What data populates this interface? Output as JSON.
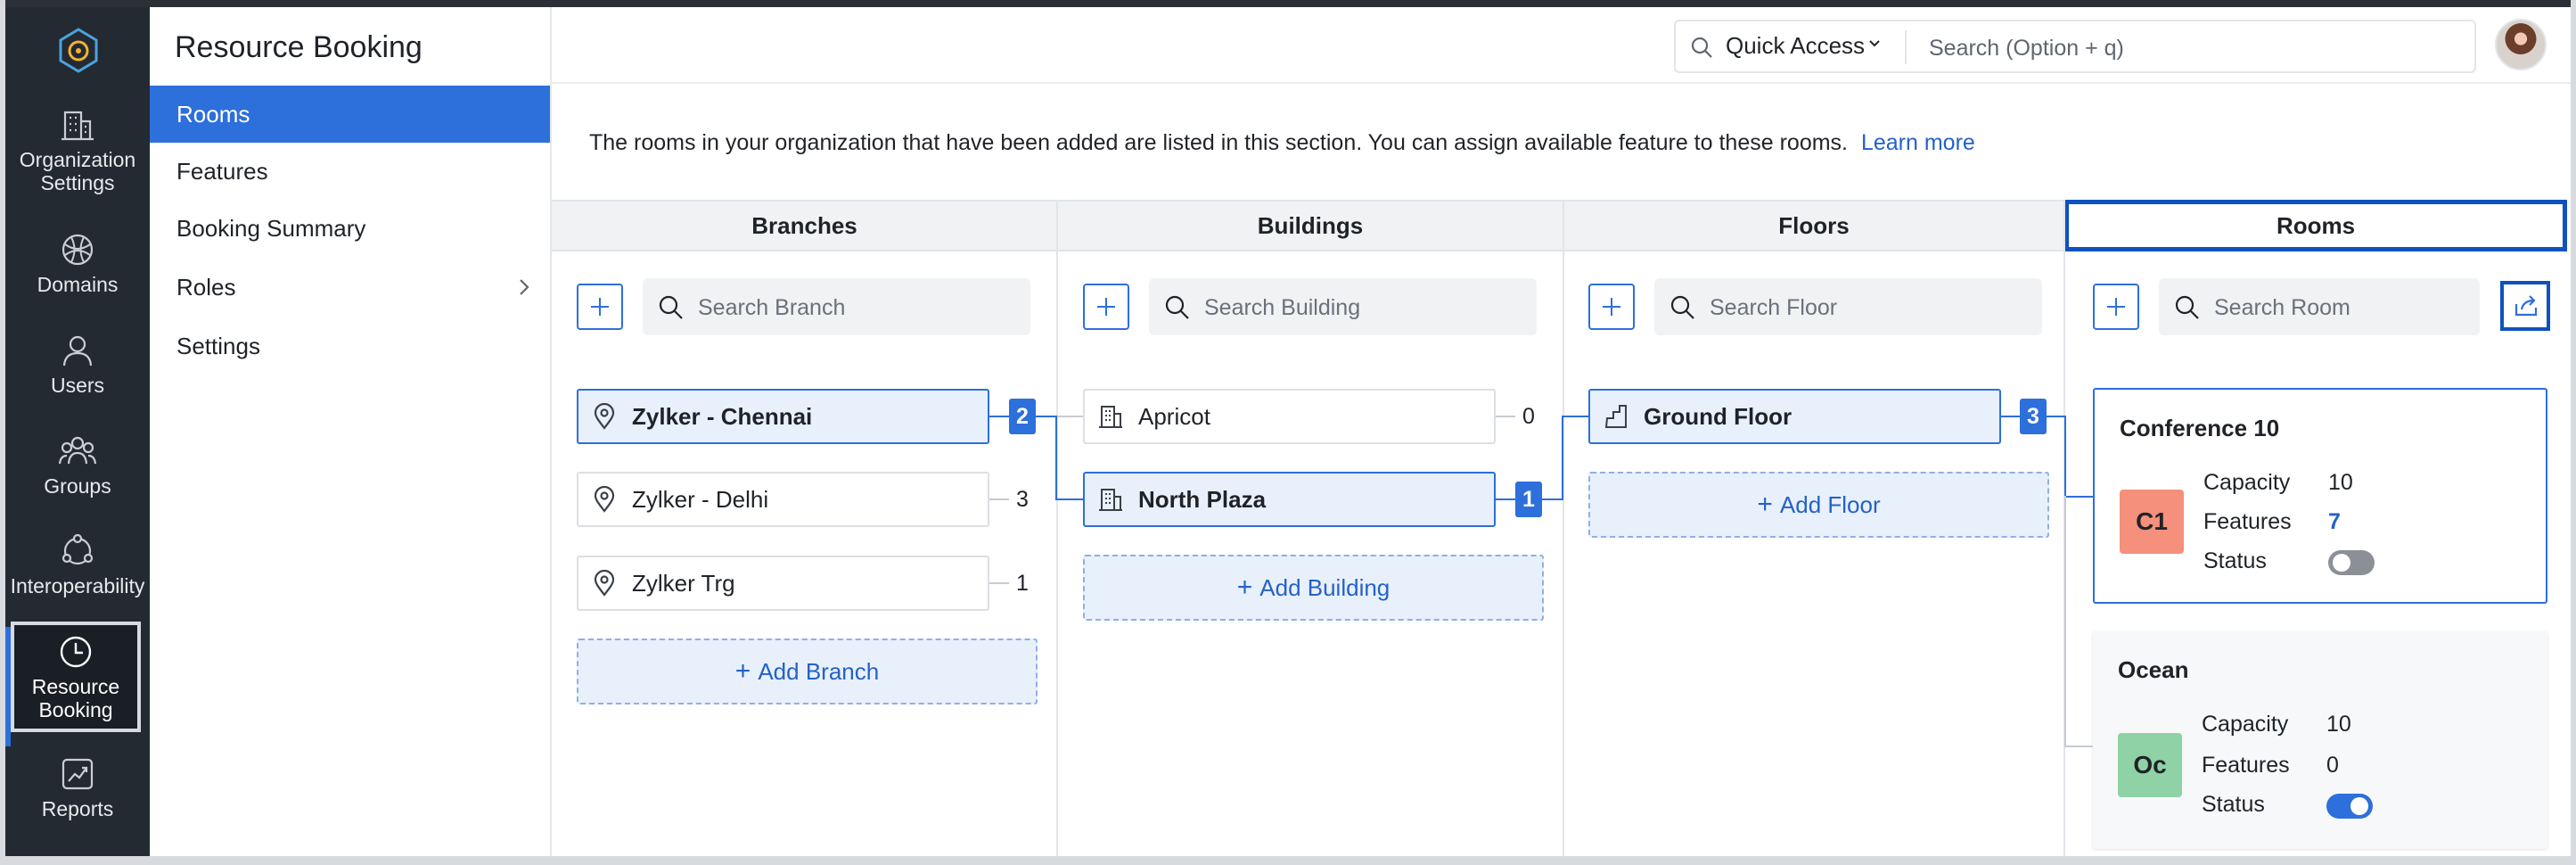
{
  "app": {
    "title": "Resource Booking"
  },
  "rail": {
    "items": [
      {
        "label1": "Organization",
        "label2": "Settings",
        "icon": "building-icon"
      },
      {
        "label1": "Domains",
        "icon": "globe-icon"
      },
      {
        "label1": "Users",
        "icon": "user-icon"
      },
      {
        "label1": "Groups",
        "icon": "groups-icon"
      },
      {
        "label1": "Interoperability",
        "icon": "interoperability-icon"
      },
      {
        "label1": "Resource",
        "label2": "Booking",
        "icon": "clock-icon",
        "active": true
      },
      {
        "label1": "Reports",
        "icon": "reports-icon"
      }
    ]
  },
  "subnav": {
    "items": [
      {
        "label": "Rooms",
        "active": true
      },
      {
        "label": "Features"
      },
      {
        "label": "Booking Summary"
      },
      {
        "label": "Roles",
        "has_submenu": true
      },
      {
        "label": "Settings"
      }
    ]
  },
  "topbar": {
    "quick_access": "Quick Access",
    "search_placeholder": "Search (Option + q)"
  },
  "intro": {
    "text": "The rooms in your organization that have been added are listed in this section. You can assign available feature to these rooms.",
    "link": "Learn more"
  },
  "columns": {
    "branches": {
      "header": "Branches",
      "search_placeholder": "Search Branch",
      "items": [
        {
          "name": "Zylker - Chennai",
          "count": "2",
          "selected": true
        },
        {
          "name": "Zylker - Delhi",
          "count": "3"
        },
        {
          "name": "Zylker Trg",
          "count": "1"
        }
      ],
      "add_label": "Add Branch"
    },
    "buildings": {
      "header": "Buildings",
      "search_placeholder": "Search Building",
      "items": [
        {
          "name": "Apricot",
          "count": "0"
        },
        {
          "name": "North Plaza",
          "count": "1",
          "selected": true
        }
      ],
      "add_label": "Add Building"
    },
    "floors": {
      "header": "Floors",
      "search_placeholder": "Search Floor",
      "items": [
        {
          "name": "Ground Floor",
          "count": "3",
          "selected": true
        }
      ],
      "add_label": "Add Floor"
    },
    "rooms": {
      "header": "Rooms",
      "search_placeholder": "Search Room",
      "items": [
        {
          "name": "Conference 10",
          "badge": "C1",
          "badge_color": "#f4907c",
          "capacity_label": "Capacity",
          "capacity": "10",
          "features_label": "Features",
          "features": "7",
          "status_label": "Status",
          "status_on": false
        },
        {
          "name": "Ocean",
          "badge": "Oc",
          "badge_color": "#8fd2a5",
          "capacity_label": "Capacity",
          "capacity": "10",
          "features_label": "Features",
          "features": "0",
          "status_label": "Status",
          "status_on": true
        }
      ]
    }
  },
  "colors": {
    "accent": "#2d6fdb",
    "rail_bg": "#242a31",
    "focus_border": "#0d52bf"
  }
}
